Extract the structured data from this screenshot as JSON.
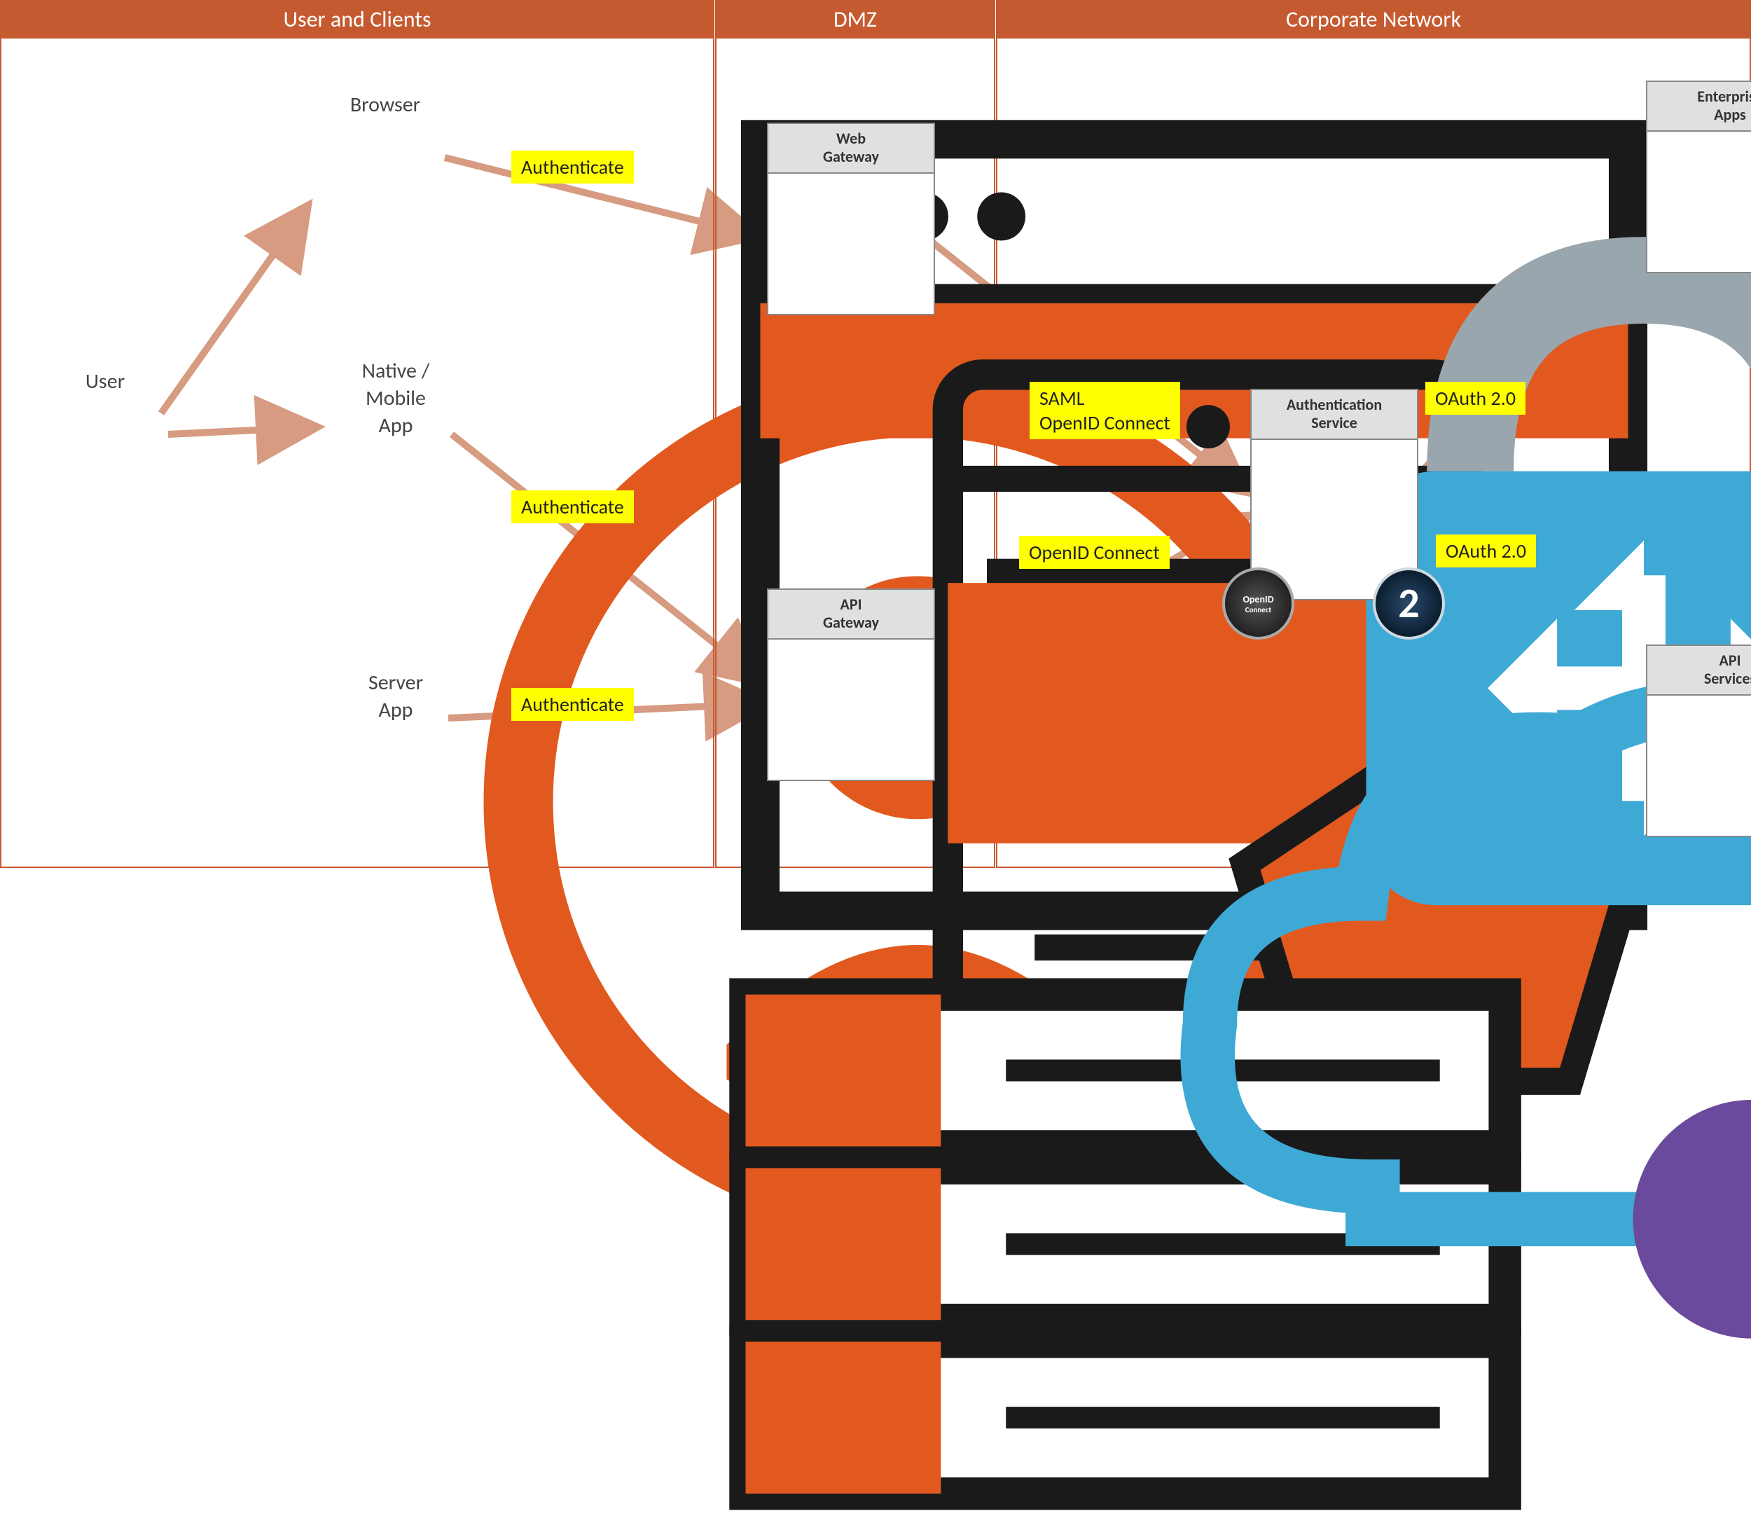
{
  "zones": {
    "user_clients": "User and Clients",
    "dmz": "DMZ",
    "corporate": "Corporate Network"
  },
  "nodes": {
    "user": "User",
    "browser": "Browser",
    "native_app": "Native /\nMobile\nApp",
    "server_app": "Server\nApp",
    "web_gateway": "Web\nGateway",
    "api_gateway": "API\nGateway",
    "auth_service": "Authentication\nService",
    "enterprise_apps": "Enterprise\nApps",
    "api_services": "API\nServices"
  },
  "labels": {
    "auth_browser": "Authenticate",
    "auth_native": "Authenticate",
    "auth_server": "Authenticate",
    "saml_openid": "SAML\nOpenID Connect",
    "openid": "OpenID Connect",
    "oauth_up": "OAuth 2.0",
    "oauth_down": "OAuth 2.0"
  },
  "badges": {
    "openid": "OpenID",
    "openid_sub": "Connect",
    "oauth": "2"
  }
}
